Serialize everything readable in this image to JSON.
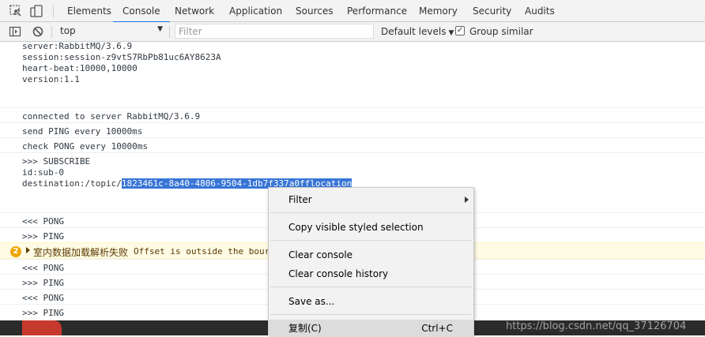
{
  "devtools": {
    "tabs": [
      {
        "label": "Elements"
      },
      {
        "label": "Console",
        "selected": true
      },
      {
        "label": "Network"
      },
      {
        "label": "Application"
      },
      {
        "label": "Sources"
      },
      {
        "label": "Performance"
      },
      {
        "label": "Memory"
      },
      {
        "label": "Security"
      },
      {
        "label": "Audits"
      }
    ],
    "icons": [
      "inspect-element-icon",
      "device-toolbar-icon"
    ]
  },
  "toolbar": {
    "context": "top",
    "filter_placeholder": "Filter",
    "levels_label": "Default levels",
    "group_similar_label": "Group similar",
    "group_similar_checked": true
  },
  "console": {
    "messages": [
      {
        "lines": [
          "server:RabbitMQ/3.6.9",
          "session:session-z9vtS7RbPb81uc6AY8623A",
          "heart-beat:10000,10000",
          "version:1.1"
        ]
      },
      {
        "lines": [
          "connected to server RabbitMQ/3.6.9"
        ]
      },
      {
        "lines": [
          "send PING every 10000ms"
        ]
      },
      {
        "lines": [
          "check PONG every 10000ms"
        ]
      },
      {
        "lines": [
          ">>> SUBSCRIBE",
          "id:sub-0"
        ],
        "dest_prefix": "destination:/topic/",
        "dest_selected": "1823461c-8a40-4806-9504-1db7f337a0fflocation"
      },
      {
        "lines": [
          "<<< PONG"
        ]
      },
      {
        "lines": [
          ">>> PING"
        ]
      },
      {
        "warning": true,
        "count": "2",
        "text_cn": "室内数据加载解析失败",
        "text_en": "Offset is outside the bour"
      },
      {
        "lines": [
          "<<< PONG"
        ]
      },
      {
        "lines": [
          ">>> PING"
        ]
      },
      {
        "lines": [
          "<<< PONG"
        ]
      },
      {
        "lines": [
          ">>> PING"
        ]
      }
    ]
  },
  "context_menu": {
    "items": [
      {
        "label": "Filter",
        "submenu": true
      },
      {
        "label": "Copy visible styled selection"
      },
      {
        "label": "Clear console"
      },
      {
        "label": "Clear console history"
      },
      {
        "label": "Save as..."
      },
      {
        "label": "复制(C)",
        "shortcut": "Ctrl+C",
        "highlighted": true
      }
    ]
  },
  "watermark": "https://blog.csdn.net/qq_37126704",
  "colors": {
    "selection": "#3875d7",
    "tab_accent": "#1a73e8",
    "warning_bg": "#fffbe5",
    "badge": "#f0a500"
  }
}
